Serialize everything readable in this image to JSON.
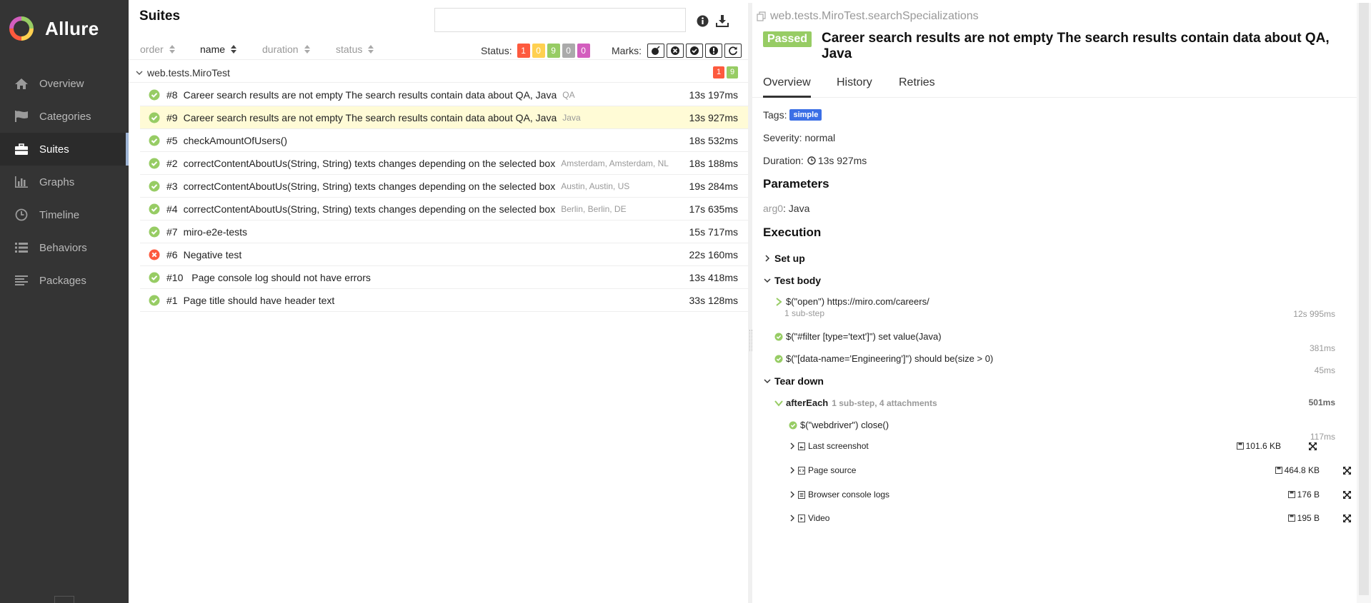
{
  "brand": {
    "name": "Allure"
  },
  "sidebar": {
    "items": [
      {
        "label": "Overview",
        "icon": "home-icon",
        "active": false
      },
      {
        "label": "Categories",
        "icon": "flag-icon",
        "active": false
      },
      {
        "label": "Suites",
        "icon": "briefcase-icon",
        "active": true
      },
      {
        "label": "Graphs",
        "icon": "bar-chart-icon",
        "active": false
      },
      {
        "label": "Timeline",
        "icon": "clock-icon",
        "active": false
      },
      {
        "label": "Behaviors",
        "icon": "list-icon",
        "active": false
      },
      {
        "label": "Packages",
        "icon": "align-left-icon",
        "active": false
      }
    ]
  },
  "suites": {
    "title": "Suites",
    "search": {
      "value": "",
      "placeholder": ""
    },
    "sort": {
      "order": "order",
      "name": "name",
      "duration": "duration",
      "status": "status"
    },
    "status_label": "Status:",
    "status_counts": [
      {
        "value": "1",
        "color": "#fd5a3e"
      },
      {
        "value": "0",
        "color": "#ffd050"
      },
      {
        "value": "9",
        "color": "#97cc64"
      },
      {
        "value": "0",
        "color": "#aaaaaa"
      },
      {
        "value": "0",
        "color": "#d35ebe"
      }
    ],
    "marks_label": "Marks:",
    "group": {
      "name": "web.tests.MiroTest",
      "failed": "1",
      "passed": "9"
    },
    "rows": [
      {
        "num": "#8",
        "name": "Career search results are not empty The search results contain data about QA, Java",
        "param": "QA",
        "duration": "13s 197ms",
        "status": "passed",
        "selected": false
      },
      {
        "num": "#9",
        "name": "Career search results are not empty The search results contain data about QA, Java",
        "param": "Java",
        "duration": "13s 927ms",
        "status": "passed",
        "selected": true
      },
      {
        "num": "#5",
        "name": "checkAmountOfUsers()",
        "param": "",
        "duration": "18s 532ms",
        "status": "passed",
        "selected": false
      },
      {
        "num": "#2",
        "name": "correctContentAboutUs(String, String) texts changes depending on the selected box",
        "param": "Amsterdam, Amsterdam, NL",
        "duration": "18s 188ms",
        "status": "passed",
        "selected": false
      },
      {
        "num": "#3",
        "name": "correctContentAboutUs(String, String) texts changes depending on the selected box",
        "param": "Austin, Austin, US",
        "duration": "19s 284ms",
        "status": "passed",
        "selected": false
      },
      {
        "num": "#4",
        "name": "correctContentAboutUs(String, String) texts changes depending on the selected box",
        "param": "Berlin, Berlin, DE",
        "duration": "17s 635ms",
        "status": "passed",
        "selected": false
      },
      {
        "num": "#7",
        "name": "miro-e2e-tests",
        "param": "",
        "duration": "15s 717ms",
        "status": "passed",
        "selected": false
      },
      {
        "num": "#6",
        "name": "Negative test",
        "param": "",
        "duration": "22s 160ms",
        "status": "failed",
        "selected": false
      },
      {
        "num": "#10",
        "name": " Page console log should not have errors",
        "param": "",
        "duration": "13s 418ms",
        "status": "passed",
        "selected": false
      },
      {
        "num": "#1",
        "name": "Page title should have header text",
        "param": "",
        "duration": "33s 128ms",
        "status": "passed",
        "selected": false
      }
    ]
  },
  "detail": {
    "fullname": "web.tests.MiroTest.searchSpecializations",
    "status": "Passed",
    "title": "Career search results are not empty The search results contain data about QA, Java",
    "tabs": [
      "Overview",
      "History",
      "Retries"
    ],
    "tags_label": "Tags:",
    "tag": "simple",
    "severity": "Severity: normal",
    "duration_label": "Duration:",
    "duration": "13s 927ms",
    "parameters_title": "Parameters",
    "param_name": "arg0",
    "param_value": ": Java",
    "execution_title": "Execution",
    "setup": "Set up",
    "test_body": "Test body",
    "body_steps": [
      {
        "text": "$(\"open\") https://miro.com/careers/",
        "note": "1 sub-step",
        "duration": "12s 995ms"
      },
      {
        "text": "$(\"#filter [type='text']\") set value(Java)",
        "duration": "381ms"
      },
      {
        "text": "$(\"[data-name='Engineering']\") should be(size > 0)",
        "duration": "45ms"
      }
    ],
    "teardown": "Tear down",
    "after_each": {
      "name": "afterEach",
      "note": "1 sub-step, 4 attachments",
      "duration": "501ms"
    },
    "close_step": {
      "text": "$(\"webdriver\") close()",
      "duration": "117ms"
    },
    "attachments": [
      {
        "name": "Last screenshot",
        "size": "101.6 KB"
      },
      {
        "name": "Page source",
        "size": "464.8 KB"
      },
      {
        "name": "Browser console logs",
        "size": "176 B"
      },
      {
        "name": "Video",
        "size": "195 B"
      }
    ]
  }
}
